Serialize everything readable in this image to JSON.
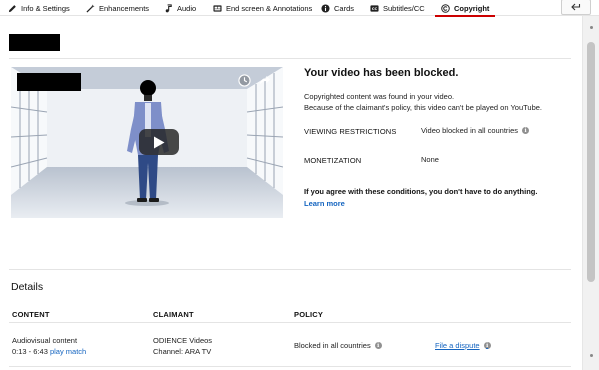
{
  "tabs": [
    {
      "label": "Info & Settings",
      "icon": "pencil-icon"
    },
    {
      "label": "Enhancements",
      "icon": "magic-wand-icon"
    },
    {
      "label": "Audio",
      "icon": "music-note-icon"
    },
    {
      "label": "End screen & Annotations",
      "icon": "end-screen-icon"
    },
    {
      "label": "Cards",
      "icon": "info-circle-icon"
    },
    {
      "label": "Subtitles/CC",
      "icon": "cc-icon"
    },
    {
      "label": "Copyright",
      "icon": "copyright-icon",
      "active": true
    }
  ],
  "player": {
    "icons": [
      "clock-icon",
      "share-icon",
      "play-icon"
    ]
  },
  "status": {
    "title": "Your video has been blocked.",
    "line1": "Copyrighted content was found in your video.",
    "line2": "Because of the claimant's policy, this video can't be played on YouTube.",
    "viewing_key": "VIEWING RESTRICTIONS",
    "viewing_val": "Video blocked in all countries",
    "monetization_key": "MONETIZATION",
    "monetization_val": "None",
    "agree_text": "If you agree with these conditions, you don't have to do anything.",
    "learn_more": "Learn more"
  },
  "details": {
    "heading": "Details",
    "columns": [
      "CONTENT",
      "CLAIMANT",
      "POLICY"
    ],
    "rows": [
      {
        "content_type": "Audiovisual content",
        "content_range": "0:13 - 6:43",
        "play_match": "play match",
        "claimant_name": "ODIENCE Videos",
        "claimant_channel": "Channel: ARA TV",
        "policy": "Blocked in all countries",
        "action": "File a dispute"
      }
    ]
  },
  "colors": {
    "accent": "#cc0000",
    "link": "#1565c0"
  }
}
